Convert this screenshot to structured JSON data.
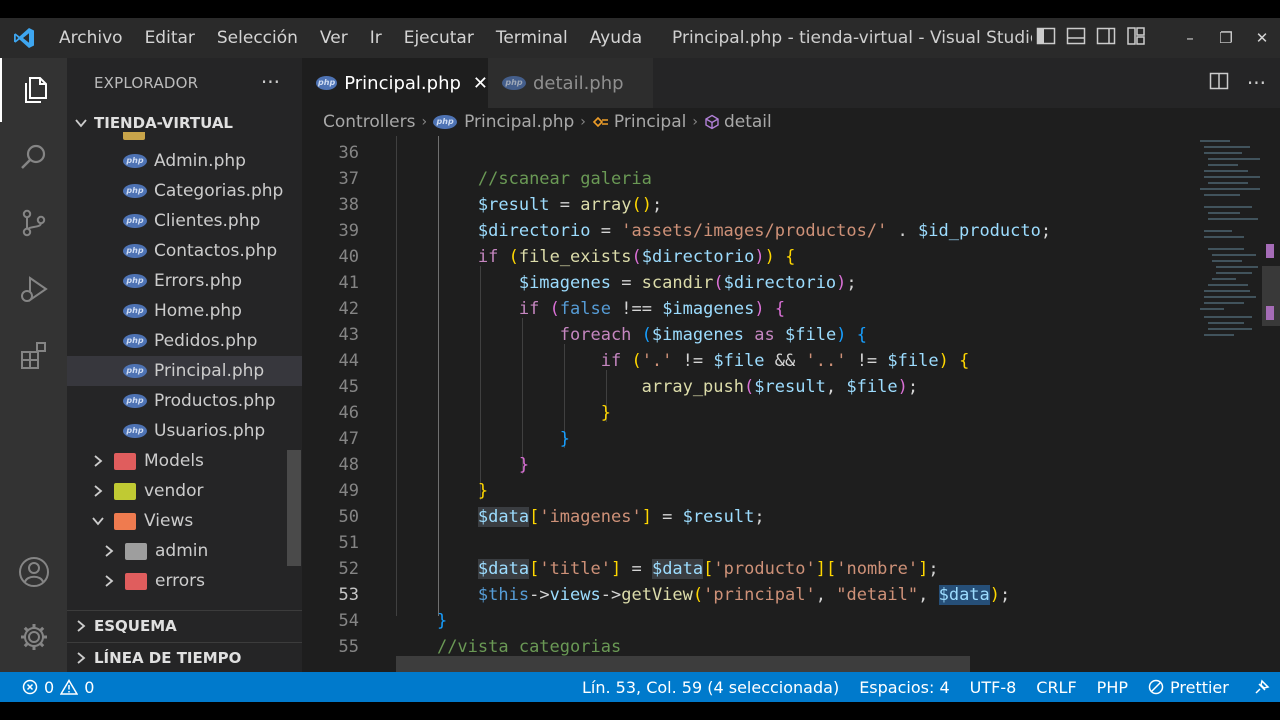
{
  "menu": [
    "Archivo",
    "Editar",
    "Selección",
    "Ver",
    "Ir",
    "Ejecutar",
    "Terminal",
    "Ayuda"
  ],
  "window_title": "Principal.php - tienda-virtual - Visual Studio Co...",
  "window_controls": {
    "minimize": "–",
    "restore": "❐",
    "close": "✕"
  },
  "activity_icons": [
    "files-icon",
    "search-icon",
    "source-control-icon",
    "run-debug-icon",
    "extensions-icon",
    "account-icon",
    "settings-gear-icon"
  ],
  "sidebar": {
    "title": "EXPLORADOR",
    "more": "···",
    "project": "TIENDA-VIRTUAL",
    "files": [
      "Admin.php",
      "Categorias.php",
      "Clientes.php",
      "Contactos.php",
      "Errors.php",
      "Home.php",
      "Pedidos.php",
      "Principal.php",
      "Productos.php",
      "Usuarios.php"
    ],
    "folders": [
      {
        "name": "Models",
        "color": "#e05d5d",
        "open": false
      },
      {
        "name": "vendor",
        "color": "#c0ca33",
        "open": false
      },
      {
        "name": "Views",
        "color": "#ef7b4f",
        "open": true
      }
    ],
    "subfolders": [
      {
        "name": "admin",
        "color": "#9e9e9e"
      },
      {
        "name": "errors",
        "color": "#e05d5d"
      }
    ],
    "outline": "ESQUEMA",
    "timeline": "LÍNEA DE TIEMPO"
  },
  "tabs": [
    {
      "label": "Principal.php",
      "active": true,
      "close": "✕"
    },
    {
      "label": "detail.php",
      "active": false
    }
  ],
  "breadcrumb": [
    "Controllers",
    "Principal.php",
    "Principal",
    "detail"
  ],
  "editor": {
    "line_numbers": [
      36,
      37,
      38,
      39,
      40,
      41,
      42,
      43,
      44,
      45,
      46,
      47,
      48,
      49,
      50,
      51,
      52,
      53,
      54,
      55
    ],
    "current_line": 53
  },
  "status": {
    "errors": "0",
    "warnings": "0",
    "position": "Lín. 53, Col. 59 (4 seleccionada)",
    "spaces": "Espacios: 4",
    "encoding": "UTF-8",
    "eol": "CRLF",
    "language": "PHP",
    "formatter": "Prettier"
  },
  "colors": {
    "accent": "#007acc",
    "php_icon": "#4e73b4"
  }
}
